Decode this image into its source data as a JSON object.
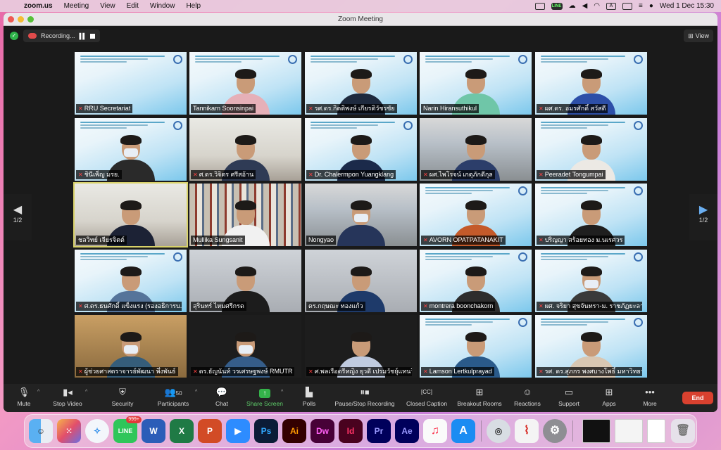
{
  "menubar": {
    "app": "zoom.us",
    "items": [
      "Meeting",
      "View",
      "Edit",
      "Window",
      "Help"
    ],
    "status_line": "LINE",
    "keyboard": "A",
    "clock": "Wed 1 Dec  15:30"
  },
  "window": {
    "title": "Zoom Meeting",
    "recording_label": "Recording...",
    "view_label": "View"
  },
  "gallery": {
    "page_left": "1/2",
    "page_right": "1/2",
    "participants": [
      {
        "name": "RRU Secretariat",
        "muted": true
      },
      {
        "name": "Tannikarn Soonsinpai",
        "muted": false
      },
      {
        "name": "รศ.ดร.กิตติพงษ์ เกียรติวัชรชัย",
        "muted": true
      },
      {
        "name": "Narin Hiransuthikul",
        "muted": false
      },
      {
        "name": "ผศ.ดร. อมรศักดิ์ สวัสดี",
        "muted": true
      },
      {
        "name": "ชินีเพ็ญ มรย.",
        "muted": true
      },
      {
        "name": "ศ.ดร.วิจิตร ศรีสอ้าน",
        "muted": true
      },
      {
        "name": "Dr. Chalermpon Yuangklang",
        "muted": true
      },
      {
        "name": "ผศ.ไพโรจน์ เกตุภักดีกุล",
        "muted": true
      },
      {
        "name": "Peeradet Tongumpai",
        "muted": true
      },
      {
        "name": "ชลวิทย์ เจียรจิตต์",
        "muted": false
      },
      {
        "name": "Mullika Sungsanit",
        "muted": false
      },
      {
        "name": "Nongyao",
        "muted": false
      },
      {
        "name": "AVORN OPATPATANAKIT",
        "muted": true
      },
      {
        "name": "ปริญญา สร้อยทอง ม.นเรศวร",
        "muted": true
      },
      {
        "name": "ศ.ดร.ธนศักดิ์ แข็งแรง (รองอธิการบ...",
        "muted": true
      },
      {
        "name": "สุรินทร์ ไหมศรีกรด",
        "muted": false
      },
      {
        "name": "ดร.กฤษณะ ทองแก้ว",
        "muted": false
      },
      {
        "name": "montrera boonchakorn",
        "muted": true
      },
      {
        "name": "ผศ. จริยา สุขจันทรา-ม. ราชภัฏยะลา",
        "muted": true
      },
      {
        "name": "ผู้ช่วยศาสตราจารย์พัฒนา พึ่งพันธ์",
        "muted": true
      },
      {
        "name": "ดร.ธัญนันท์ วรเศรษฐพงษ์ RMUTR",
        "muted": true
      },
      {
        "name": "ศ.พลเรือตรีหญิง ยุวดี เปรมวัชยุ์แทนวิ...",
        "muted": true
      },
      {
        "name": "Lamson Lertkulprayad",
        "muted": true
      },
      {
        "name": "รศ. ดร.สุภกร พงศบางโพธิ์ มหาวิทยา...",
        "muted": true
      }
    ]
  },
  "toolbar": {
    "mute": "Mute",
    "stop_video": "Stop Video",
    "security": "Security",
    "participants": "Participants",
    "participants_count": "50",
    "chat": "Chat",
    "share_screen": "Share Screen",
    "polls": "Polls",
    "pause_stop_recording": "Pause/Stop Recording",
    "closed_caption": "Closed Caption",
    "breakout_rooms": "Breakout Rooms",
    "reactions": "Reactions",
    "support": "Support",
    "apps": "Apps",
    "more": "More",
    "end": "End"
  },
  "dock": {
    "line_badge": "999+",
    "apps": [
      "Finder",
      "Launchpad",
      "Safari",
      "LINE",
      "Word",
      "Excel",
      "PowerPoint",
      "Zoom",
      "Photoshop",
      "Illustrator",
      "Dreamweaver",
      "InDesign",
      "Premiere Pro",
      "After Effects",
      "Music",
      "App Store",
      "QuickTime",
      "Acrobat",
      "System Preferences",
      "Window 1",
      "Window 2",
      "Window 3",
      "Trash"
    ],
    "labels": {
      "ps": "Ps",
      "ai": "Ai",
      "dw": "Dw",
      "id": "Id",
      "pr": "Pr",
      "ae": "Ae",
      "word": "W",
      "excel": "X",
      "ppt": "P"
    }
  }
}
